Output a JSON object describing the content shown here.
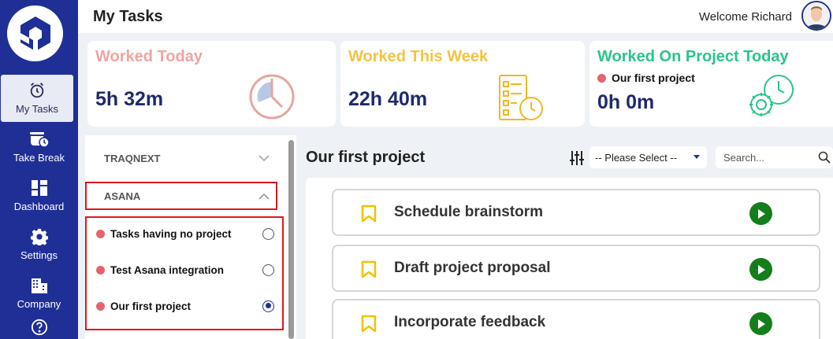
{
  "app": {
    "nav": [
      {
        "label": "My Tasks",
        "icon": "alarm-clock-icon",
        "active": true
      },
      {
        "label": "Take Break",
        "icon": "coffee-break-icon"
      },
      {
        "label": "Dashboard",
        "icon": "dashboard-grid-icon"
      },
      {
        "label": "Settings",
        "icon": "gear-icon"
      },
      {
        "label": "Company",
        "icon": "building-icon"
      },
      {
        "label": "",
        "icon": "help-icon"
      }
    ]
  },
  "header": {
    "title": "My Tasks",
    "welcome": "Welcome Richard"
  },
  "stats": {
    "today": {
      "title": "Worked Today",
      "value": "5h 32m",
      "color": "#f0a3a3"
    },
    "week": {
      "title": "Worked This Week",
      "value": "22h 40m",
      "color": "#f3c443"
    },
    "project_today": {
      "title": "Worked On Project Today",
      "project": "Our first project",
      "value": "0h 0m",
      "color": "#2bc48a"
    }
  },
  "projects_panel": {
    "groups": [
      {
        "label": "TRAQNEXT",
        "expanded": false
      },
      {
        "label": "ASANA",
        "expanded": true
      }
    ],
    "items": [
      {
        "label": "Tasks having no project",
        "selected": false
      },
      {
        "label": "Test Asana integration",
        "selected": false
      },
      {
        "label": "Our first project",
        "selected": true
      }
    ]
  },
  "main": {
    "title": "Our first project",
    "filter": {
      "selected": "-- Please Select --"
    },
    "search": {
      "placeholder": "Search..."
    },
    "tasks": [
      {
        "title": "Schedule brainstorm"
      },
      {
        "title": "Draft project proposal"
      },
      {
        "title": "Incorporate feedback"
      }
    ]
  },
  "colors": {
    "sidebar": "#1f2f96",
    "accent_dot": "#e6636b",
    "play_button": "#137e1a",
    "bookmark": "#f2c200",
    "highlight": "#e0181b"
  }
}
